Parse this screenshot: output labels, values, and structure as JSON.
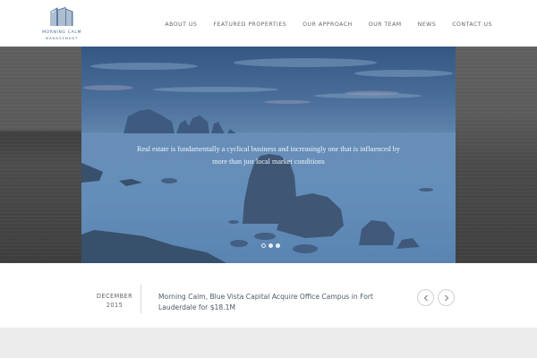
{
  "header": {
    "logo": {
      "line1": "MORNING CALM",
      "line2": "MANAGEMENT",
      "icon": "building-logo-icon",
      "color": "#4a6f96"
    },
    "nav": [
      {
        "label": "ABOUT US"
      },
      {
        "label": "FEATURED PROPERTIES"
      },
      {
        "label": "OUR APPROACH"
      },
      {
        "label": "OUR TEAM"
      },
      {
        "label": "NEWS"
      },
      {
        "label": "CONTACT US"
      }
    ]
  },
  "hero": {
    "caption": "Real estate is fundamentally a cyclical business and increasingly one that is influenced by more than just local market conditions",
    "slides_count": 3,
    "active_slide": 1,
    "tint": "#4f78a6"
  },
  "news": {
    "date_month": "DECEMBER",
    "date_year": "2015",
    "headline": "Morning Calm, Blue Vista Capital Acquire Office Campus in Fort Lauderdale for $18.1M",
    "prev_icon": "chevron-left-icon",
    "next_icon": "chevron-right-icon"
  }
}
